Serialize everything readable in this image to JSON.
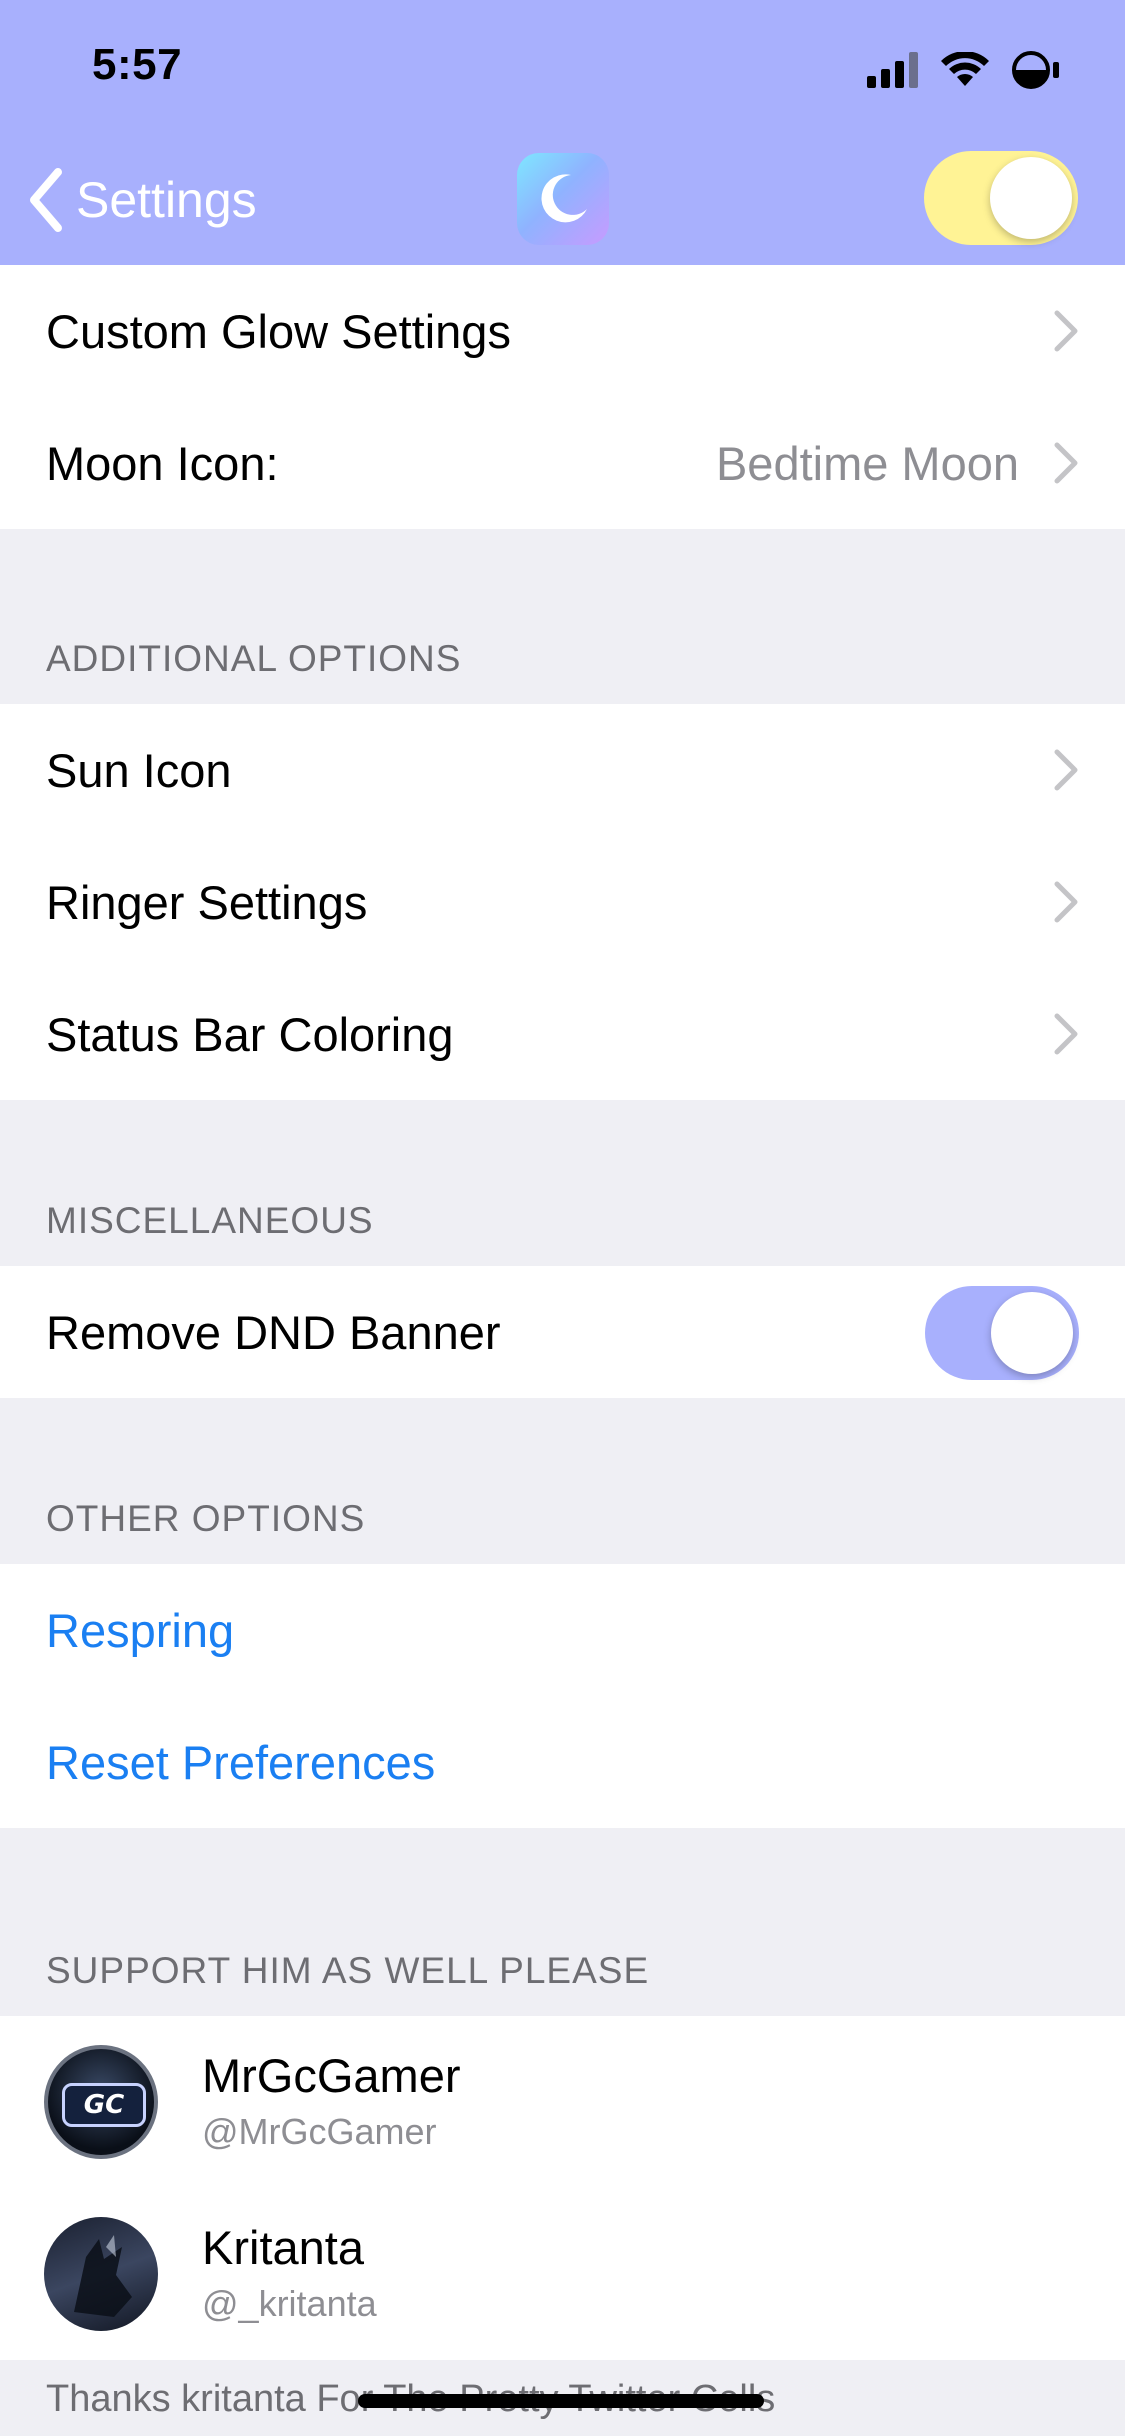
{
  "status_bar": {
    "time": "5:57"
  },
  "nav": {
    "back_label": "Settings",
    "master_enabled": true
  },
  "colors": {
    "accent": "#a8b0fd",
    "master_toggle": "#fff395",
    "link": "#1a7ff2"
  },
  "main_group": {
    "rows": [
      {
        "label": "Custom Glow Settings"
      },
      {
        "label": "Moon Icon:",
        "value": "Bedtime Moon"
      }
    ]
  },
  "additional": {
    "header": "ADDITIONAL OPTIONS",
    "rows": [
      {
        "label": "Sun Icon"
      },
      {
        "label": "Ringer Settings"
      },
      {
        "label": "Status Bar Coloring"
      }
    ]
  },
  "misc": {
    "header": "MISCELLANEOUS",
    "rows": [
      {
        "label": "Remove DND Banner",
        "enabled": true
      }
    ]
  },
  "other": {
    "header": "OTHER OPTIONS",
    "rows": [
      {
        "label": "Respring"
      },
      {
        "label": "Reset Preferences"
      }
    ]
  },
  "support": {
    "header": "SUPPORT HIM AS WELL PLEASE",
    "people": [
      {
        "name": "MrGcGamer",
        "handle": "@MrGcGamer",
        "avatar_text": "GC"
      },
      {
        "name": "Kritanta",
        "handle": "@_kritanta"
      }
    ],
    "footer": "Thanks kritanta For The Pretty Twitter Cells"
  }
}
